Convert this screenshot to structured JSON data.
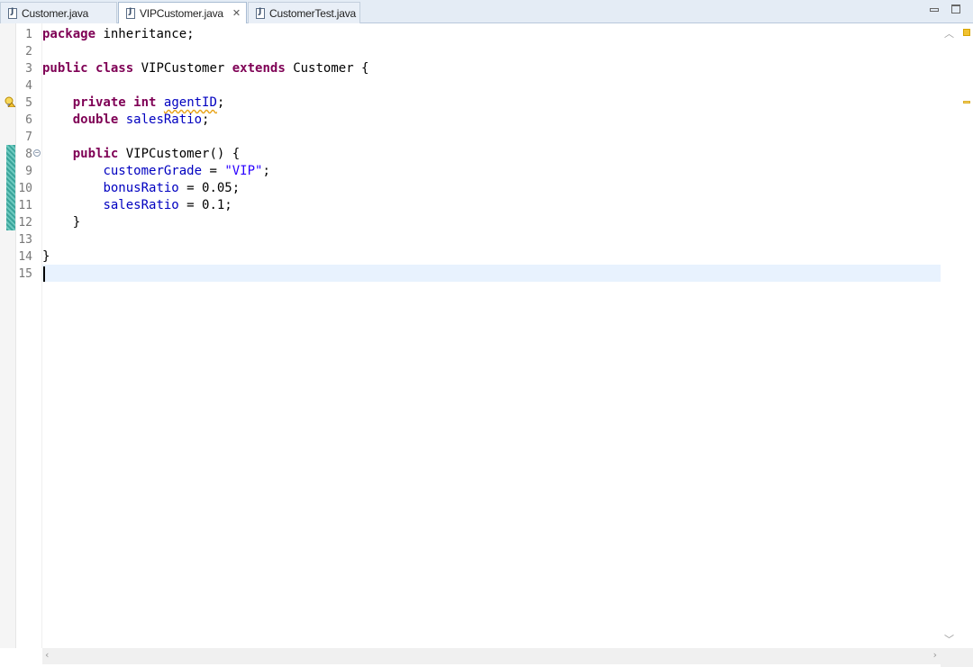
{
  "tabs": [
    {
      "label": "Customer.java",
      "icon": "java-file-icon",
      "active": false
    },
    {
      "label": "VIPCustomer.java",
      "icon": "java-file-icon",
      "active": true,
      "close": "✕"
    },
    {
      "label": "CustomerTest.java",
      "icon": "java-file-icon",
      "active": false
    }
  ],
  "window_buttons": {
    "minimize": "minimize-icon",
    "maximize": "maximize-icon"
  },
  "editor": {
    "line_numbers": [
      "1",
      "2",
      "3",
      "4",
      "5",
      "6",
      "7",
      "8",
      "9",
      "10",
      "11",
      "12",
      "13",
      "14",
      "15"
    ],
    "code": {
      "l1_kw": "package",
      "l1_rest": " inheritance;",
      "l3_kw1": "public",
      "l3_kw2": "class",
      "l3_name": " VIPCustomer ",
      "l3_kw3": "extends",
      "l3_rest": " Customer {",
      "l5_kw1": "private",
      "l5_kw2": "int",
      "l5_field": "agentID",
      "l5_semi": ";",
      "l6_kw": "double",
      "l6_field": "salesRatio",
      "l6_semi": ";",
      "l8_kw": "public",
      "l8_rest": " VIPCustomer() {",
      "l9_field": "customerGrade",
      "l9_eq": " = ",
      "l9_str": "\"VIP\"",
      "l9_semi": ";",
      "l10_field": "bonusRatio",
      "l10_rest": " = 0.05;",
      "l11_field": "salesRatio",
      "l11_rest": " = 0.1;",
      "l12": "}",
      "l14": "}"
    },
    "current_line": 15,
    "colors": {
      "keyword": "#7f0055",
      "field": "#0000c0",
      "string": "#2a00ff",
      "current_line_bg": "#e8f2fe",
      "change_bar": "#3aa59b",
      "warning": "#f1c232"
    }
  }
}
